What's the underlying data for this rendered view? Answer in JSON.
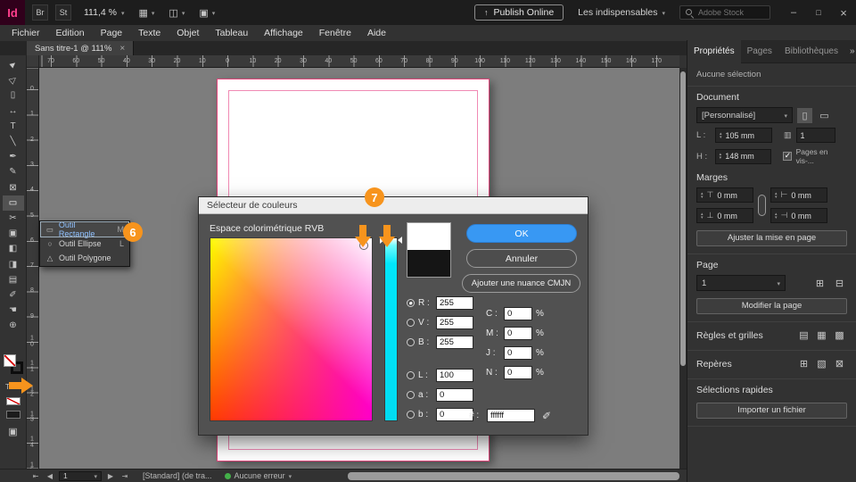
{
  "topbar": {
    "logo": "Id",
    "bridge_badge": "Br",
    "stock_badge": "St",
    "zoom_level": "111,4 %",
    "publish_button": "Publish Online",
    "workspace_menu": "Les indispensables",
    "search_placeholder": "Adobe Stock"
  },
  "menubar": {
    "items": [
      "Fichier",
      "Edition",
      "Page",
      "Texte",
      "Objet",
      "Tableau",
      "Affichage",
      "Fenêtre",
      "Aide"
    ]
  },
  "document_tab": {
    "title": "Sans titre-1 @ 111%"
  },
  "rulers": {
    "horizontal": [
      "70",
      "60",
      "50",
      "40",
      "30",
      "20",
      "10",
      "0",
      "10",
      "20",
      "30",
      "40",
      "50",
      "60",
      "70",
      "80",
      "90",
      "100",
      "110",
      "120",
      "130",
      "140",
      "150",
      "160",
      "170"
    ],
    "vertical": [
      "0",
      "1",
      "2",
      "3",
      "4",
      "5",
      "6",
      "7",
      "8",
      "9",
      "10",
      "11",
      "12",
      "13",
      "14",
      "15"
    ]
  },
  "toolbar": {
    "tools": [
      {
        "name": "selection-tool",
        "glyph": "►"
      },
      {
        "name": "direct-selection-tool",
        "glyph": "▷"
      },
      {
        "name": "page-tool",
        "glyph": "▯"
      },
      {
        "name": "gap-tool",
        "glyph": "↔"
      },
      {
        "name": "type-tool",
        "glyph": "T"
      },
      {
        "name": "line-tool",
        "glyph": "╲"
      },
      {
        "name": "pen-tool",
        "glyph": "✒"
      },
      {
        "name": "pencil-tool",
        "glyph": "✎"
      },
      {
        "name": "rectangle-frame-tool",
        "glyph": "⊠"
      },
      {
        "name": "rectangle-tool",
        "glyph": "▭",
        "selected": true
      },
      {
        "name": "scissors-tool",
        "glyph": "✂"
      },
      {
        "name": "free-transform-tool",
        "glyph": "▣"
      },
      {
        "name": "gradient-swatch-tool",
        "glyph": "◧"
      },
      {
        "name": "gradient-feather-tool",
        "glyph": "◨"
      },
      {
        "name": "note-tool",
        "glyph": "▤"
      },
      {
        "name": "eyedropper-tool",
        "glyph": "✐"
      },
      {
        "name": "hand-tool",
        "glyph": "☚"
      },
      {
        "name": "zoom-tool",
        "glyph": "⊕"
      }
    ]
  },
  "tool_flyout": {
    "items": [
      {
        "icon": "▭",
        "label": "Outil Rectangle",
        "shortcut": "M"
      },
      {
        "icon": "○",
        "label": "Outil Ellipse",
        "shortcut": "L"
      },
      {
        "icon": "△",
        "label": "Outil Polygone",
        "shortcut": ""
      }
    ]
  },
  "annotations": {
    "badge6": "6",
    "badge7": "7"
  },
  "dialog": {
    "title": "Sélecteur de couleurs",
    "space_label": "Espace colorimétrique RVB",
    "ok": "OK",
    "cancel": "Annuler",
    "add_swatch": "Ajouter une nuance CMJN",
    "rgb": [
      {
        "label": "R :",
        "value": "255"
      },
      {
        "label": "V :",
        "value": "255"
      },
      {
        "label": "B :",
        "value": "255"
      }
    ],
    "lab": [
      {
        "label": "L :",
        "value": "100"
      },
      {
        "label": "a :",
        "value": "0"
      },
      {
        "label": "b :",
        "value": "0"
      }
    ],
    "cmyk": [
      {
        "label": "C :",
        "value": "0",
        "suffix": "%"
      },
      {
        "label": "M :",
        "value": "0",
        "suffix": "%"
      },
      {
        "label": "J :",
        "value": "0",
        "suffix": "%"
      },
      {
        "label": "N :",
        "value": "0",
        "suffix": "%"
      }
    ],
    "hex_label": "# :",
    "hex_value": "ffffff"
  },
  "panel": {
    "tabs": [
      {
        "label": "Propriétés"
      },
      {
        "label": "Pages"
      },
      {
        "label": "Bibliothèques"
      }
    ],
    "selection_status": "Aucune sélection",
    "document": {
      "heading": "Document",
      "preset": "[Personnalisé]",
      "width_label": "L :",
      "width": "105 mm",
      "height_label": "H :",
      "height": "148 mm",
      "pages_count": "1",
      "facing_pages": "Pages en vis-...",
      "margins_heading": "Marges",
      "margins": [
        "0 mm",
        "0 mm",
        "0 mm",
        "0 mm"
      ],
      "adjust_button": "Ajuster la mise en page"
    },
    "page": {
      "heading": "Page",
      "current": "1",
      "edit_button": "Modifier la page"
    },
    "rules_heading": "Règles et grilles",
    "guides_heading": "Repères",
    "quick_heading": "Sélections rapides",
    "import_button": "Importer un fichier"
  },
  "statusbar": {
    "page": "1",
    "preflight": "[Standard] (de tra...",
    "errors": "Aucune erreur"
  },
  "colors": {
    "accent_blue": "#3898f3",
    "annotation_orange": "#f7941d",
    "guide_pink": "#e0447a",
    "no_error_green": "#43b049"
  }
}
